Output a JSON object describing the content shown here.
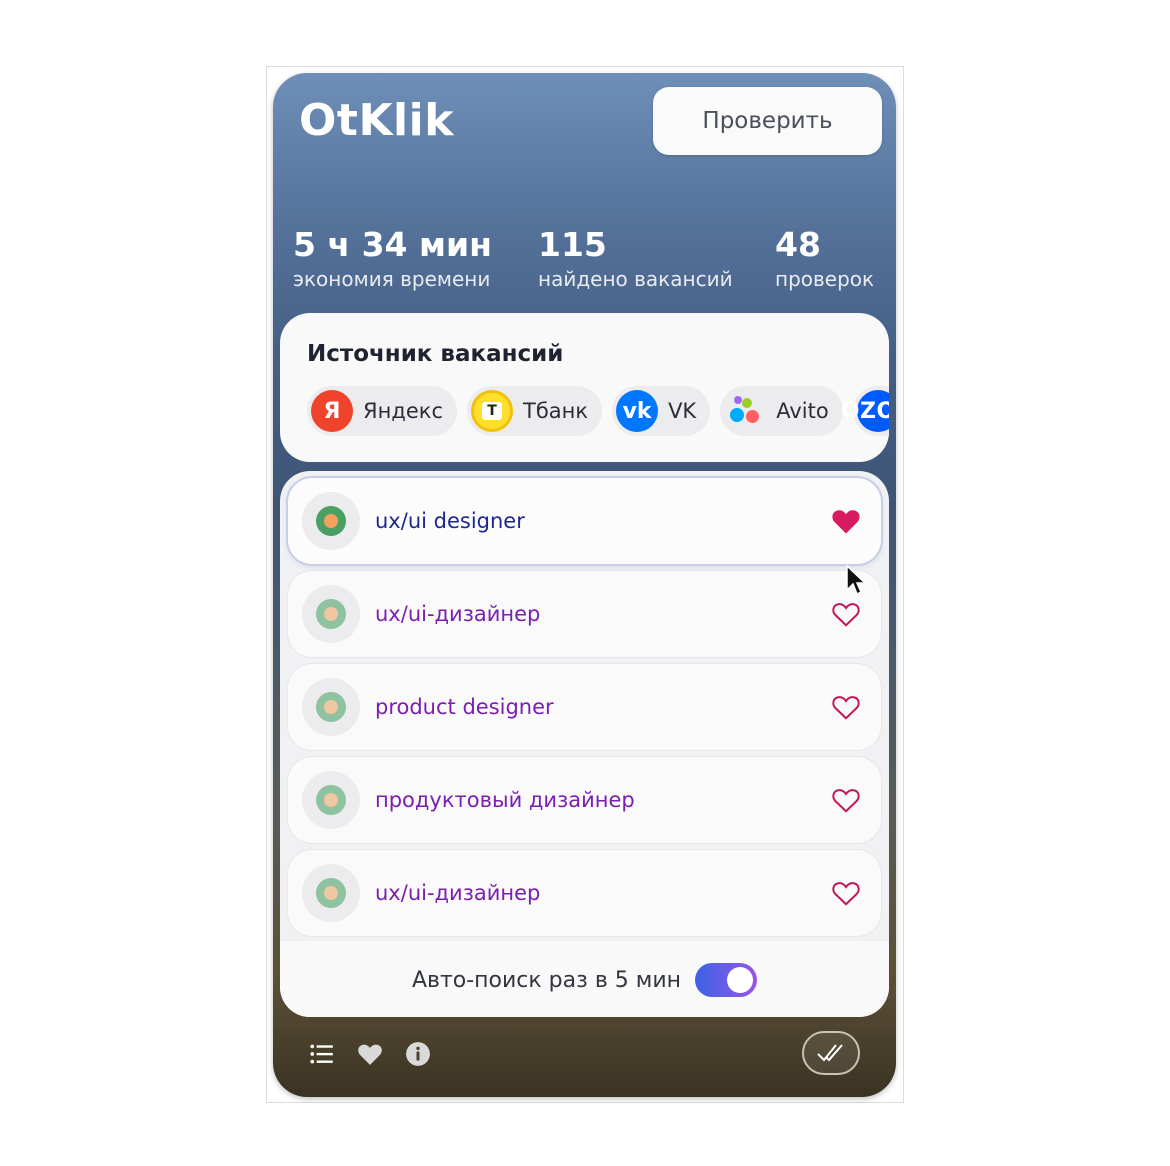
{
  "app": {
    "title": "OtKlik"
  },
  "header": {
    "check_button": "Проверить"
  },
  "stats": [
    {
      "value": "5 ч 34 мин",
      "label": "экономия времени"
    },
    {
      "value": "115",
      "label": "найдено вакансий"
    },
    {
      "value": "48",
      "label": "проверок"
    }
  ],
  "sources": {
    "title": "Источник вакансий",
    "items": [
      {
        "label": "Яндекс",
        "icon": "yandex-icon",
        "glyph": "Я"
      },
      {
        "label": "Тбанк",
        "icon": "tbank-icon",
        "glyph": "T"
      },
      {
        "label": "VK",
        "icon": "vk-icon",
        "glyph": "vk"
      },
      {
        "label": "Avito",
        "icon": "avito-icon"
      },
      {
        "label": "OZON",
        "icon": "ozon-icon",
        "glyph": "OZON"
      }
    ]
  },
  "jobs": [
    {
      "title": "ux/ui designer",
      "favorite": true
    },
    {
      "title": "ux/ui-дизайнер",
      "favorite": false
    },
    {
      "title": "product designer",
      "favorite": false
    },
    {
      "title": "продуктовый дизайнер",
      "favorite": false
    },
    {
      "title": "ux/ui-дизайнер",
      "favorite": false
    }
  ],
  "autosearch": {
    "label": "Авто-поиск раз в 5 мин",
    "enabled": true
  },
  "colors": {
    "accent_heart": "#d81b60",
    "title_active": "#1e2790",
    "title_default": "#7a1fb0",
    "toggle_from": "#3b63e6",
    "toggle_to": "#9a54e6"
  },
  "bottom_nav": [
    "list-icon",
    "heart-icon",
    "info-icon",
    "double-check-icon"
  ]
}
